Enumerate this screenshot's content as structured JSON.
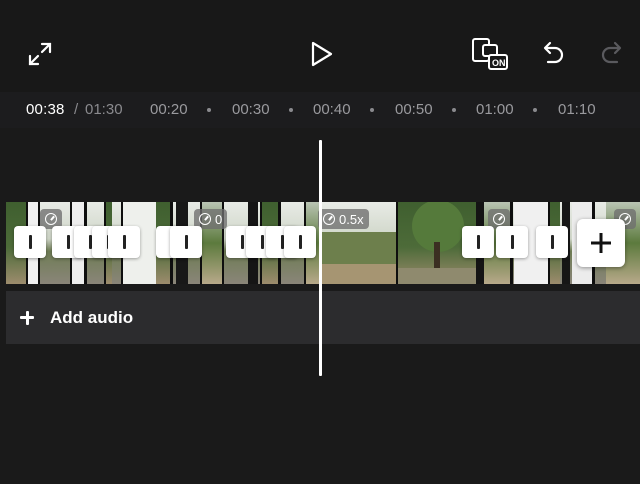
{
  "toolbar": {
    "fullscreen_icon": "expand-arrows-icon",
    "play_icon": "play-triangle-icon",
    "preview_mode_label": "ON",
    "undo_icon": "undo-arrow-icon",
    "redo_icon": "redo-arrow-icon"
  },
  "timeline": {
    "current_time": "00:38",
    "separator": "/",
    "total_time": "01:30",
    "ticks": [
      "00:20",
      "00:30",
      "00:40",
      "00:50",
      "01:00",
      "01:10"
    ]
  },
  "clips": {
    "badge_values": [
      "0",
      "0.5x"
    ]
  },
  "audio": {
    "add_label": "Add audio"
  },
  "colors": {
    "background": "#1c1c1e",
    "toolbar": "#181818",
    "audio_row": "#2c2c2e",
    "playhead": "#ffffff"
  }
}
